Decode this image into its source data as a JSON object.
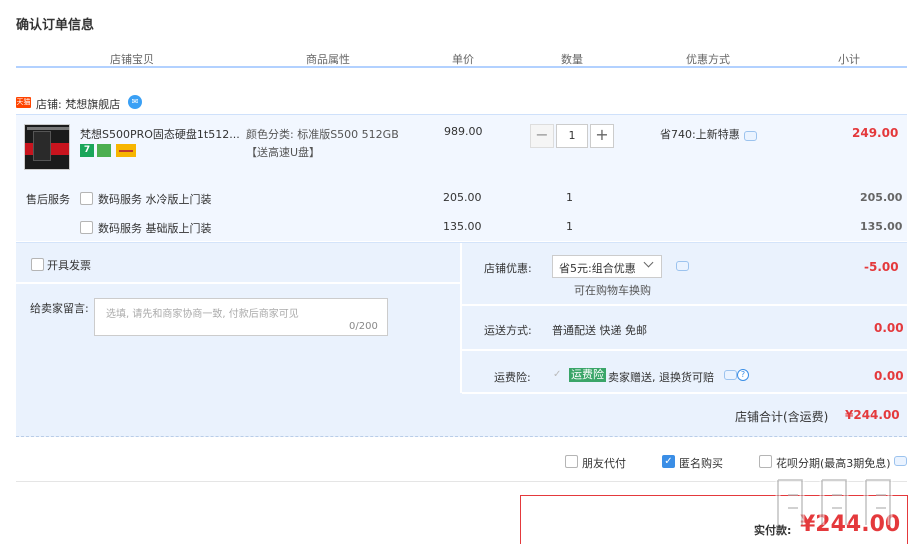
{
  "page_title": "确认订单信息",
  "columns": [
    "店铺宝贝",
    "商品属性",
    "单价",
    "数量",
    "优惠方式",
    "小计"
  ],
  "shop": {
    "tag": "天猫",
    "label": "店铺: 梵想旗舰店"
  },
  "item": {
    "title": "梵想S500PRO固态硬盘1t512...",
    "badge_seven": "7",
    "attr_line1": "颜色分类: 标准版S500 512GB",
    "attr_line2": "【送高速U盘】",
    "price": "989.00",
    "qty_minus": "−",
    "qty": "1",
    "qty_plus": "+",
    "discount": "省740:上新特惠",
    "subtotal": "249.00"
  },
  "after_sales": {
    "label": "售后服务",
    "services": [
      {
        "name": "数码服务 水冷版上门装",
        "price": "205.00",
        "qty": "1",
        "subtotal": "205.00"
      },
      {
        "name": "数码服务 基础版上门装",
        "price": "135.00",
        "qty": "1",
        "subtotal": "135.00"
      }
    ]
  },
  "invoice": {
    "label": "开具发票"
  },
  "remark": {
    "label": "给卖家留言:",
    "placeholder": "选填, 请先和商家协商一致, 付款后商家可见",
    "count": "0/200"
  },
  "coupon": {
    "label": "店铺优惠:",
    "selected": "省5元:组合优惠",
    "note": "可在购物车换购",
    "amount": "-5.00"
  },
  "shipping": {
    "label": "运送方式:",
    "value": "普通配送 快递 免邮",
    "amount": "0.00"
  },
  "insurance": {
    "label": "运费险:",
    "tag": "运费险",
    "text": "卖家赠送, 退换货可赔",
    "amount": "0.00"
  },
  "shop_total": {
    "label": "店铺合计(含运费)",
    "amount": "¥244.00"
  },
  "options": [
    {
      "label": "朋友代付",
      "checked": false
    },
    {
      "label": "匿名购买",
      "checked": true
    },
    {
      "label": "花呗分期(最高3期免息)",
      "checked": false
    }
  ],
  "payment": {
    "label": "实付款:",
    "amount": "¥244.00"
  },
  "colors": {
    "accent_red": "#e4393c",
    "header_line": "#b2d1ff",
    "panel_bg": "#eaf2fd",
    "tag_green": "#3aa568"
  }
}
